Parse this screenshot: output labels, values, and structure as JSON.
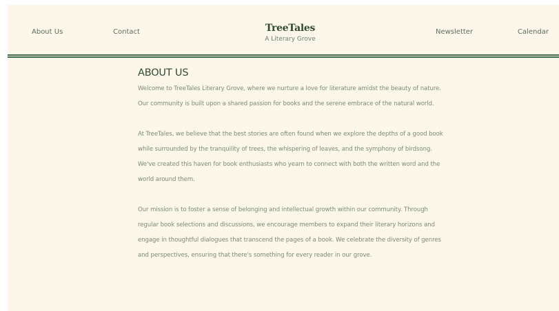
{
  "header": {
    "nav_left": [
      {
        "label": "About Us"
      },
      {
        "label": "Contact"
      }
    ],
    "brand": {
      "title": "TreeTales",
      "tagline": "A Literary Grove"
    },
    "nav_right": [
      {
        "label": "Newsletter"
      },
      {
        "label": "Calendar"
      }
    ]
  },
  "main": {
    "heading": "ABOUT US",
    "paragraphs": [
      "Welcome to TreeTales Literary Grove, where we nurture a love for literature amidst the beauty of nature. Our community is built upon a shared passion for books and the serene embrace of the natural world.",
      "At TreeTales, we believe that the best stories are often found when we explore the depths of a good book while surrounded by the tranquility of trees, the whispering of leaves, and the symphony of birdsong. We've created this haven for book enthusiasts who yearn to connect with both the written word and the world around them.",
      "Our mission is to foster a sense of belonging and intellectual growth within our community. Through regular book selections and discussions, we encourage members to expand their literary horizons and engage in thoughtful dialogues that transcend the pages of a book. We celebrate the diversity of genres and perspectives, ensuring that there's something for every reader in our grove."
    ]
  },
  "colors": {
    "background": "#fdf7eb",
    "accent": "#3f6b4a",
    "heading": "#2f4a33",
    "body_text": "#7a8a74"
  }
}
